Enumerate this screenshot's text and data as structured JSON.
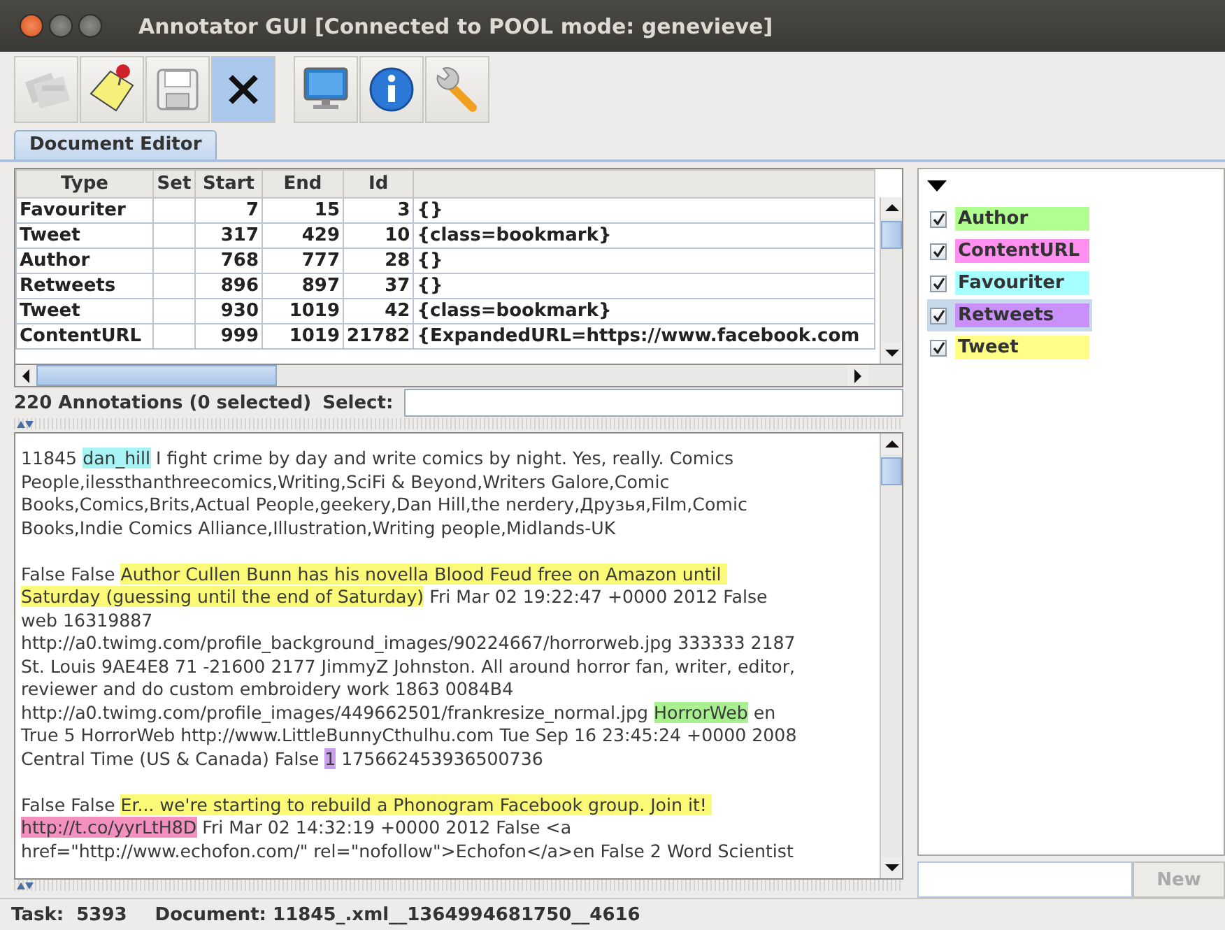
{
  "window": {
    "title": "Annotator GUI [Connected to POOL mode: genevieve]"
  },
  "toolbar": [
    {
      "kind": "documents",
      "disabled": true,
      "selected": false
    },
    {
      "kind": "note",
      "disabled": false,
      "selected": false
    },
    {
      "kind": "save",
      "disabled": false,
      "selected": false
    },
    {
      "kind": "close",
      "disabled": false,
      "selected": true
    },
    {
      "kind": "monitor",
      "disabled": false,
      "selected": false
    },
    {
      "kind": "info",
      "disabled": false,
      "selected": false
    },
    {
      "kind": "wrench",
      "disabled": false,
      "selected": false
    }
  ],
  "tabs": [
    {
      "label": "Document Editor",
      "selected": true
    }
  ],
  "table": {
    "columns": [
      "Type",
      "Set",
      "Start",
      "End",
      "Id"
    ],
    "rows": [
      {
        "type": "Favouriter",
        "start": "7",
        "end": "15",
        "id": "3",
        "features": "{}"
      },
      {
        "type": "Tweet",
        "start": "317",
        "end": "429",
        "id": "10",
        "features": "{class=bookmark}"
      },
      {
        "type": "Author",
        "start": "768",
        "end": "777",
        "id": "28",
        "features": "{}"
      },
      {
        "type": "Retweets",
        "start": "896",
        "end": "897",
        "id": "37",
        "features": "{}"
      },
      {
        "type": "Tweet",
        "start": "930",
        "end": "1019",
        "id": "42",
        "features": "{class=bookmark}"
      },
      {
        "type": "ContentURL",
        "start": "999",
        "end": "1019",
        "id": "21782",
        "features": "{ExpandedURL=https://www.facebook.com"
      }
    ]
  },
  "annotation_count": "220 Annotations (0 selected)",
  "select_label": "Select:",
  "document": {
    "paragraphs": [
      {
        "lines": [
          [
            {
              "text": "11845 "
            },
            {
              "text": "dan_hill",
              "color": "#a8f4f4"
            },
            {
              "text": " I fight crime by day and write comics by night. Yes, really. Comics"
            }
          ],
          [
            {
              "text": "People,ilessthanthreecomics,Writing,SciFi & Beyond,Writers Galore,Comic"
            }
          ],
          [
            {
              "text": "Books,Comics,Brits,Actual People,geekery,Dan Hill,the nerdery,Друзья,Film,Comic"
            }
          ],
          [
            {
              "text": "Books,Indie Comics Alliance,Illustration,Writing people,Midlands-UK"
            }
          ]
        ]
      },
      {
        "lines": [
          [
            {
              "text": "False False "
            },
            {
              "text": "Author Cullen Bunn has his novella Blood Feud free on Amazon until ",
              "color": "#fafa78"
            }
          ],
          [
            {
              "text": "Saturday (guessing until the end of Saturday)",
              "color": "#fafa78"
            },
            {
              "text": " Fri Mar 02 19:22:47 +0000 2012 False"
            }
          ],
          [
            {
              "text": "web 16319887"
            }
          ],
          [
            {
              "text": "http://a0.twimg.com/profile_background_images/90224667/horrorweb.jpg 333333 2187"
            }
          ],
          [
            {
              "text": "St. Louis 9AE4E8 71 -21600 2177 JimmyZ Johnston. All around horror fan, writer, editor,"
            }
          ],
          [
            {
              "text": "reviewer and do custom embroidery work 1863 0084B4"
            }
          ],
          [
            {
              "text": "http://a0.twimg.com/profile_images/449662501/frankresize_normal.jpg "
            },
            {
              "text": "HorrorWeb",
              "color": "#a8f090"
            },
            {
              "text": " en"
            }
          ],
          [
            {
              "text": "True 5 HorrorWeb http://www.LittleBunnyCthulhu.com Tue Sep 16 23:45:24 +0000 2008"
            }
          ],
          [
            {
              "text": "Central Time (US & Canada) False "
            },
            {
              "text": "1",
              "color": "#c8a0e8"
            },
            {
              "text": " 175662453936500736"
            }
          ]
        ]
      },
      {
        "lines": [
          [
            {
              "text": "False False "
            },
            {
              "text": "Er... we're starting to rebuild a Phonogram Facebook group. Join it! ",
              "color": "#fafa78"
            }
          ],
          [
            {
              "text": "http://t.co/yyrLtH8D",
              "color": "#f490c0"
            },
            {
              "text": " Fri Mar 02 14:32:19 +0000 2012 False <a"
            }
          ],
          [
            {
              "text": "href=\"http://www.echofon.com/\" rel=\"nofollow\">Echofon</a>en False 2 Word Scientist"
            }
          ]
        ]
      }
    ]
  },
  "legend": [
    {
      "label": "Author",
      "color": "#b0ff90",
      "checked": true,
      "selected": false
    },
    {
      "label": "ContentURL",
      "color": "#ff90f0",
      "checked": true,
      "selected": false
    },
    {
      "label": "Favouriter",
      "color": "#a8ffff",
      "checked": true,
      "selected": false
    },
    {
      "label": "Retweets",
      "color": "#c890f8",
      "checked": true,
      "selected": true
    },
    {
      "label": "Tweet",
      "color": "#ffff88",
      "checked": true,
      "selected": false
    }
  ],
  "new_button": {
    "label": "New",
    "disabled": true
  },
  "status_bar": [
    "Task:  5393",
    "Document: 11845_.xml__1364994681750__4616"
  ]
}
